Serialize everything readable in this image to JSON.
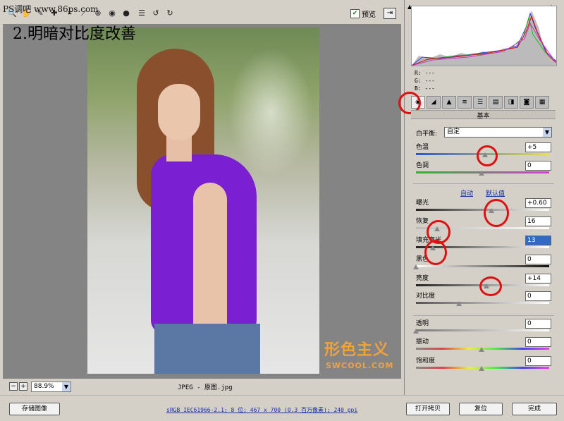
{
  "watermark": "PS调吧 www.86ps.com",
  "overlay_title": "2.明暗对比度改善",
  "toolbar": {
    "preview_label": "预览",
    "tools": [
      "zoom-tool-icon",
      "hand-tool-icon",
      "white-balance-tool-icon",
      "color-sampler-icon",
      "crop-tool-icon",
      "straighten-tool-icon",
      "retouch-tool-icon",
      "red-eye-tool-icon",
      "preferences-icon",
      "rotate-left-icon",
      "rotate-right-icon"
    ]
  },
  "stamp": {
    "logo": "形色主义",
    "url": "SWCOOL.COM"
  },
  "zoom": {
    "value": "88.9%"
  },
  "file_label": "JPEG -  原图.jpg",
  "footer": {
    "save_label": "存储图像",
    "info_text": "sRGB IEC61966-2.1; 8 位; 467 x 700 (0.3 百万像素); 240 ppi",
    "open_label": "打开拷贝",
    "reset_label": "复位",
    "done_label": "完成"
  },
  "readout": {
    "r": "R: ---",
    "g": "G: ---",
    "b": "B: ---"
  },
  "panel": {
    "title": "基本",
    "white_balance_label": "白平衡:",
    "white_balance_value": "自定",
    "auto_label": "自动",
    "default_label": "默认值",
    "sliders": [
      {
        "label": "色温",
        "value": "+5",
        "level": 0.53
      },
      {
        "label": "色调",
        "value": "0",
        "level": 0.5
      },
      {
        "label": "曝光",
        "value": "+0.60",
        "level": 0.58
      },
      {
        "label": "恢复",
        "value": "16",
        "level": 0.16
      },
      {
        "label": "填充亮光",
        "value": "13",
        "level": 0.13
      },
      {
        "label": "黑色",
        "value": "0",
        "level": 0.0
      },
      {
        "label": "亮度",
        "value": "+14",
        "level": 0.54
      },
      {
        "label": "对比度",
        "value": "0",
        "level": 0.33
      },
      {
        "label": "透明",
        "value": "0",
        "level": 0.0
      },
      {
        "label": "振动",
        "value": "0",
        "level": 0.5
      },
      {
        "label": "饱和度",
        "value": "0",
        "level": 0.5
      }
    ]
  },
  "colors": {
    "accent": "#316ac5",
    "annotation": "#e01010",
    "stamp": "#f3a23a"
  }
}
